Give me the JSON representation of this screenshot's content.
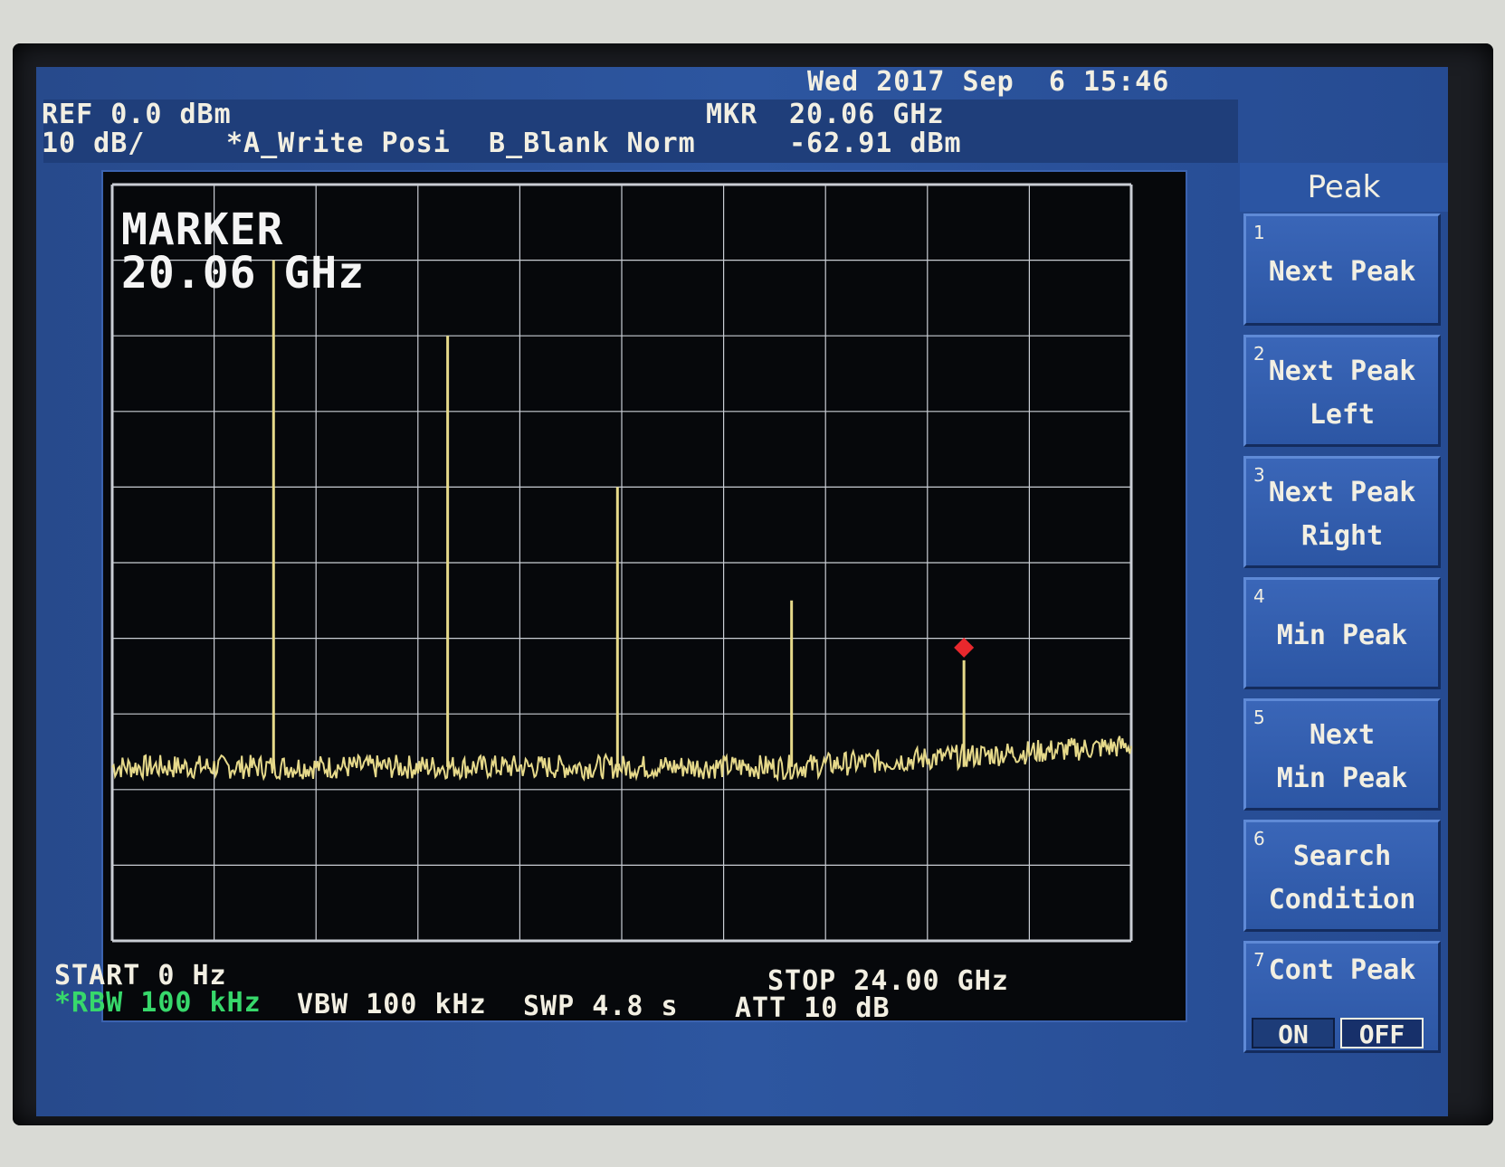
{
  "status": {
    "datetime": "Wed 2017 Sep  6 15:46",
    "ref": "REF 0.0 dBm",
    "scale": "10 dB/",
    "trace_a": "*A_Write Posi",
    "trace_b": "B_Blank Norm",
    "mkr_label": "MKR",
    "mkr_freq": "20.06 GHz",
    "mkr_level": "-62.91 dBm"
  },
  "plot": {
    "marker_title": "MARKER",
    "marker_freq": "20.06 GHz",
    "trace_color": "#e6d98a",
    "marker_color": "#e8282d",
    "grid_color": "#c9cdd4"
  },
  "footer": {
    "start": "START 0 Hz",
    "stop": "STOP 24.00 GHz",
    "rbw": "*RBW 100 kHz",
    "vbw": "VBW 100 kHz",
    "swp": "SWP 4.8 s",
    "att": "ATT 10 dB"
  },
  "softkeys": {
    "title": "Peak",
    "keys": [
      {
        "num": "1",
        "label": "Next Peak"
      },
      {
        "num": "2",
        "label": "Next Peak\nLeft"
      },
      {
        "num": "3",
        "label": "Next Peak\nRight"
      },
      {
        "num": "4",
        "label": "Min Peak"
      },
      {
        "num": "5",
        "label": "Next\nMin Peak"
      },
      {
        "num": "6",
        "label": "Search\nCondition"
      },
      {
        "num": "7",
        "label": "Cont Peak",
        "on": "ON",
        "off": "OFF"
      }
    ]
  },
  "chart_data": {
    "type": "line",
    "xlabel": "",
    "ylabel": "",
    "xlim": [
      0,
      24.0
    ],
    "ylim": [
      -100,
      0
    ],
    "x_unit": "GHz",
    "y_unit": "dBm",
    "grid": true,
    "noise_floor_dbm": -77,
    "peaks": [
      {
        "x": 3.8,
        "y": -10
      },
      {
        "x": 7.9,
        "y": -20
      },
      {
        "x": 11.9,
        "y": -40
      },
      {
        "x": 16.0,
        "y": -55
      },
      {
        "x": 20.06,
        "y": -62.91
      }
    ],
    "marker": {
      "x": 20.06,
      "y": -62.91
    }
  }
}
